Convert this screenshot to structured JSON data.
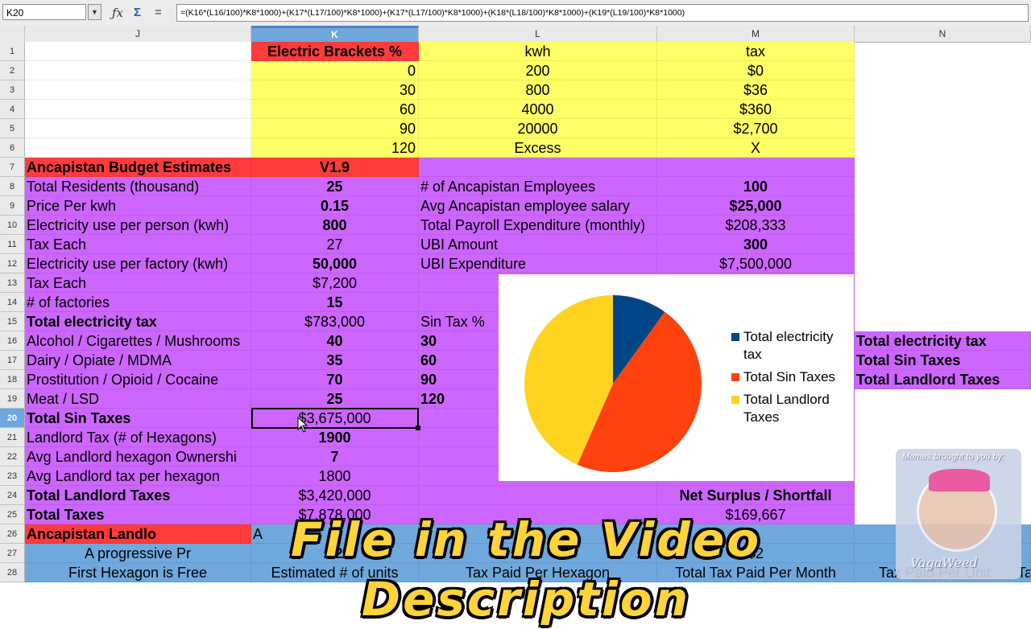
{
  "formula_bar": {
    "cell_ref": "K20",
    "formula": "=(K16*(L16/100)*K8*1000)+(K17*(L17/100)*K8*1000)+(K17*(L17/100)*K8*1000)+(K18*(L18/100)*K8*1000)+(K19*(L19/100)*K8*1000)",
    "wizard_icon": "function-wizard-icon",
    "sum_icon": "sum-icon",
    "equals_label": "="
  },
  "columns": [
    "J",
    "K",
    "L",
    "M",
    "N"
  ],
  "rows": [
    "1",
    "2",
    "3",
    "4",
    "5",
    "6",
    "7",
    "8",
    "9",
    "10",
    "11",
    "12",
    "13",
    "14",
    "15",
    "16",
    "17",
    "18",
    "19",
    "20",
    "21",
    "22",
    "23",
    "24",
    "25",
    "26",
    "27",
    "28"
  ],
  "brackets": {
    "headers": [
      "Electric Brackets %",
      "kwh",
      "tax"
    ],
    "rows": [
      [
        "0",
        "200",
        "$0"
      ],
      [
        "30",
        "800",
        "$36"
      ],
      [
        "60",
        "4000",
        "$360"
      ],
      [
        "90",
        "20000",
        "$2,700"
      ],
      [
        "120",
        "Excess",
        "X"
      ]
    ]
  },
  "budget": {
    "title": "Ancapistan Budget Estimates",
    "version": "V1.9",
    "left": [
      [
        "Total Residents (thousand)",
        "25"
      ],
      [
        "Price Per kwh",
        "0.15"
      ],
      [
        "Electricity use per person (kwh)",
        "800"
      ],
      [
        "Tax Each",
        "27"
      ],
      [
        "Electricity use per factory (kwh)",
        "50,000"
      ],
      [
        "Tax Each",
        "$7,200"
      ],
      [
        "# of factories",
        "15"
      ],
      [
        "Total electricity tax",
        "$783,000"
      ],
      [
        "Alcohol / Cigarettes / Mushrooms",
        "40"
      ],
      [
        "Dairy / Opiate / MDMA",
        "35"
      ],
      [
        "Prostitution / Opioid / Cocaine",
        "70"
      ],
      [
        "Meat / LSD",
        "25"
      ],
      [
        "Total Sin Taxes",
        "$3,675,000"
      ],
      [
        "Landlord Tax (# of Hexagons)",
        "1900"
      ],
      [
        "Avg Landlord hexagon Ownershi",
        "7"
      ],
      [
        "Avg Landlord tax per hexagon",
        "1800"
      ],
      [
        "Total Landlord Taxes",
        "$3,420,000"
      ],
      [
        "Total Taxes",
        "$7,878,000"
      ]
    ],
    "right": [
      [
        "# of Ancapistan Employees",
        "100"
      ],
      [
        "Avg Ancapistan employee salary",
        "$25,000"
      ],
      [
        "Total Payroll Expenditure (monthly)",
        "$208,333"
      ],
      [
        "UBI Amount",
        "300"
      ],
      [
        "UBI Expenditure",
        "$7,500,000"
      ]
    ],
    "sin_tax_label": "Sin Tax %",
    "sin_tax_values": [
      "30",
      "60",
      "90",
      "120"
    ],
    "net_label": "Net Surplus / Shortfall",
    "net_value": "$169,667"
  },
  "row26": {
    "j": "Ancapistan Landlo",
    "k": "A",
    "l": "a",
    "m": "",
    "n": ""
  },
  "row27": {
    "j": "A progressive Pr",
    "k": "12",
    "l": "0",
    "m": "$2",
    "n": ""
  },
  "row28": {
    "j": "First Hexagon is Free",
    "k": "Estimated # of units",
    "l": "Tax Paid Per Hexagon",
    "m": "Total Tax Paid Per Month",
    "n": "Tax Paid Per Unit",
    "o": "Ta"
  },
  "side_labels": [
    "Total electricity tax",
    "Total Sin Taxes",
    "Total Landlord Taxes"
  ],
  "banner": "File in the Video Description",
  "watermark_text": "Memes brought to you by:",
  "watermark_signature": "VagaWeed",
  "chart_data": {
    "type": "pie",
    "categories": [
      "Total electricity tax",
      "Total Sin Taxes",
      "Total Landlord Taxes"
    ],
    "values": [
      783000,
      3675000,
      3420000
    ],
    "colors": [
      "#004586",
      "#ff420e",
      "#ffd320"
    ],
    "legend": "right"
  }
}
